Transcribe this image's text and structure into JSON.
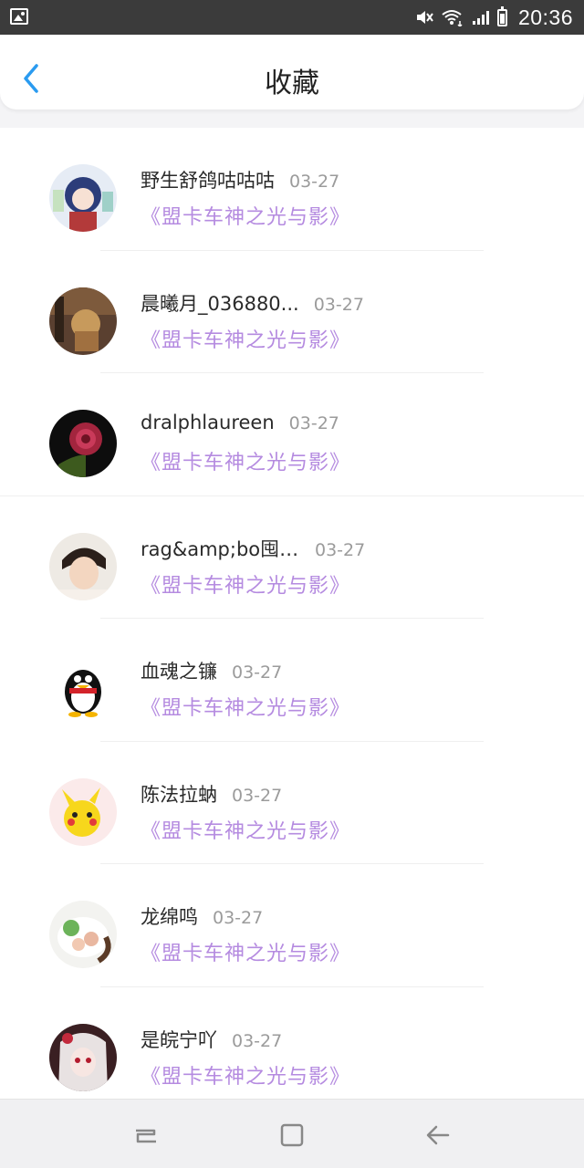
{
  "status_bar": {
    "time": "20:36"
  },
  "header": {
    "title": "收藏"
  },
  "items": [
    {
      "name": "野生舒鸽咕咕咕",
      "date": "03-27",
      "book": "《盟卡车神之光与影》"
    },
    {
      "name": "晨曦月_036880...",
      "date": "03-27",
      "book": "《盟卡车神之光与影》"
    },
    {
      "name": "dralphlaureen",
      "date": "03-27",
      "book": "《盟卡车神之光与影》"
    },
    {
      "name": "rag&amp;bo囤n...",
      "date": "03-27",
      "book": "《盟卡车神之光与影》"
    },
    {
      "name": "血魂之镰",
      "date": "03-27",
      "book": "《盟卡车神之光与影》"
    },
    {
      "name": "陈法拉蚋",
      "date": "03-27",
      "book": "《盟卡车神之光与影》"
    },
    {
      "name": "龙绵鸣",
      "date": "03-27",
      "book": "《盟卡车神之光与影》"
    },
    {
      "name": "是皖宁吖",
      "date": "03-27",
      "book": "《盟卡车神之光与影》"
    }
  ],
  "colors": {
    "accent": "#2a9bf0",
    "book_title": "#b58be0"
  }
}
